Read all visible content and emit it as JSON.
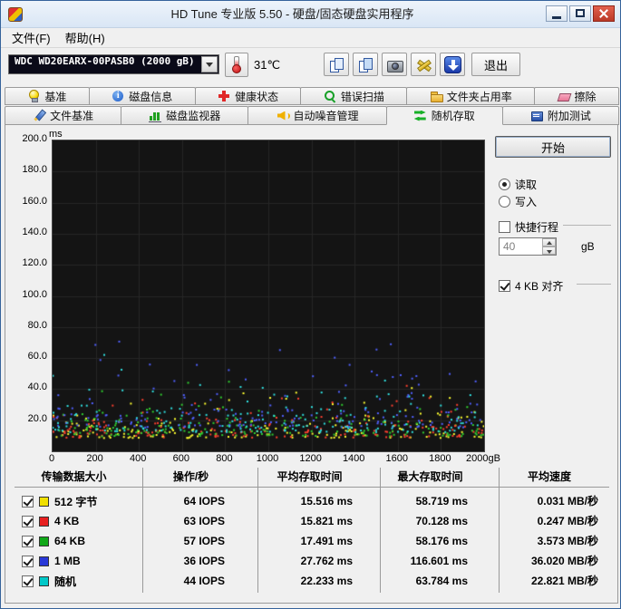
{
  "window": {
    "title": "HD Tune 专业版 5.50 - 硬盘/固态硬盘实用程序"
  },
  "menu": {
    "items": [
      {
        "name": "file",
        "label": "文件(F)"
      },
      {
        "name": "help",
        "label": "帮助(H)"
      }
    ]
  },
  "toolbar": {
    "drive": "WDC WD20EARX-00PASB0 (2000 gB)",
    "temperature": "31℃",
    "exit_label": "退出"
  },
  "tabs": {
    "row1": [
      {
        "name": "benchmark",
        "icon": "bulb",
        "label": "基准",
        "active": false
      },
      {
        "name": "disk-info",
        "icon": "info",
        "label": "磁盘信息",
        "active": false
      },
      {
        "name": "health",
        "icon": "health",
        "label": "健康状态",
        "active": false
      },
      {
        "name": "error-scan",
        "icon": "scan",
        "label": "错误扫描",
        "active": false
      },
      {
        "name": "folder-usage",
        "icon": "folder",
        "label": "文件夹占用率",
        "active": false
      },
      {
        "name": "erase",
        "icon": "erase",
        "label": "擦除",
        "active": false
      }
    ],
    "row2": [
      {
        "name": "file-benchmark",
        "icon": "pen",
        "label": "文件基准",
        "active": false
      },
      {
        "name": "disk-monitor",
        "icon": "bars",
        "label": "磁盘监视器",
        "active": false
      },
      {
        "name": "aam",
        "icon": "speaker",
        "label": "自动噪音管理",
        "active": false
      },
      {
        "name": "random-access",
        "icon": "random",
        "label": "随机存取",
        "active": true
      },
      {
        "name": "extra-tests",
        "icon": "tests",
        "label": "附加测试",
        "active": false
      }
    ]
  },
  "controls": {
    "start_label": "开始",
    "read_label": "读取",
    "write_label": "写入",
    "read_selected": true,
    "write_selected": false,
    "shortstroke_label": "快捷行程",
    "shortstroke_checked": false,
    "shortstroke_value": "40",
    "unit_label": "gB",
    "align_label": "4 KB 对齐",
    "align_checked": true
  },
  "chart_data": {
    "type": "scatter",
    "ylabel": "ms",
    "x_unit": "gB",
    "x_range": [
      0,
      2000
    ],
    "y_range": [
      0,
      200
    ],
    "grid": true,
    "y_ticks": [
      "200.0",
      "180.0",
      "160.0",
      "140.0",
      "120.0",
      "100.0",
      "80.0",
      "60.0",
      "40.0",
      "20.0"
    ],
    "x_ticks": [
      "0",
      "200",
      "400",
      "600",
      "800",
      "1000",
      "1200",
      "1400",
      "1600",
      "1800",
      "2000gB"
    ],
    "series": [
      {
        "name": "512 字节",
        "color": "#f0e000",
        "avg_access_ms": 15.516,
        "max_access_ms": 58.719
      },
      {
        "name": "4 KB",
        "color": "#e82020",
        "avg_access_ms": 15.821,
        "max_access_ms": 70.128
      },
      {
        "name": "64 KB",
        "color": "#10a818",
        "avg_access_ms": 17.491,
        "max_access_ms": 58.176
      },
      {
        "name": "1 MB",
        "color": "#2838d8",
        "avg_access_ms": 27.762,
        "max_access_ms": 116.601
      },
      {
        "name": "随机",
        "color": "#00c8c8",
        "avg_access_ms": 22.233,
        "max_access_ms": 63.784
      }
    ]
  },
  "table": {
    "headers": [
      "传输数据大小",
      "操作/秒",
      "平均存取时间",
      "最大存取时间",
      "平均速度"
    ],
    "rows": [
      {
        "name": "512-bytes",
        "checked": true,
        "color": "#f0e000",
        "label": "512 字节",
        "ops": "64 IOPS",
        "avg_time": "15.516 ms",
        "max_time": "58.719 ms",
        "speed": "0.031 MB/秒"
      },
      {
        "name": "4-kb",
        "checked": true,
        "color": "#e82020",
        "label": "4 KB",
        "ops": "63 IOPS",
        "avg_time": "15.821 ms",
        "max_time": "70.128 ms",
        "speed": "0.247 MB/秒"
      },
      {
        "name": "64-kb",
        "checked": true,
        "color": "#10a818",
        "label": "64 KB",
        "ops": "57 IOPS",
        "avg_time": "17.491 ms",
        "max_time": "58.176 ms",
        "speed": "3.573 MB/秒"
      },
      {
        "name": "1-mb",
        "checked": true,
        "color": "#2838d8",
        "label": "1 MB",
        "ops": "36 IOPS",
        "avg_time": "27.762 ms",
        "max_time": "116.601 ms",
        "speed": "36.020 MB/秒"
      },
      {
        "name": "random",
        "checked": true,
        "color": "#00c8c8",
        "label": "随机",
        "ops": "44 IOPS",
        "avg_time": "22.233 ms",
        "max_time": "63.784 ms",
        "speed": "22.821 MB/秒"
      }
    ]
  }
}
